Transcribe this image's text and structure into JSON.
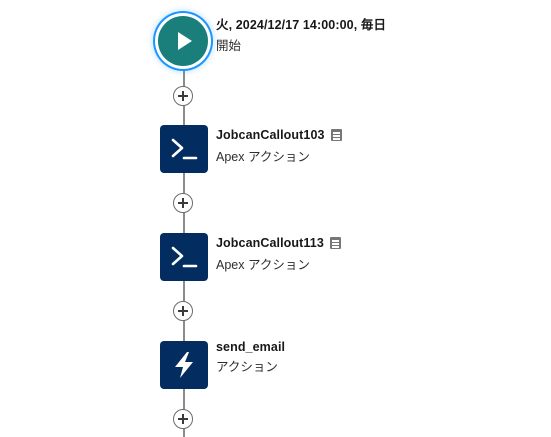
{
  "start": {
    "schedule": "火, 2024/12/17 14:00:00, 毎日",
    "label": "開始",
    "icon": "play-icon",
    "color": "#1a7f7a"
  },
  "nodes": [
    {
      "title": "JobcanCallout103",
      "subtitle": "Apex アクション",
      "icon": "terminal-icon",
      "has_doc": true
    },
    {
      "title": "JobcanCallout113",
      "subtitle": "Apex アクション",
      "icon": "terminal-icon",
      "has_doc": true
    },
    {
      "title": "send_email",
      "subtitle": "アクション",
      "icon": "lightning-bolt-icon",
      "has_doc": false
    }
  ],
  "colors": {
    "node_bg": "#032d60",
    "connector": "#8b8b8b",
    "selection_ring": "#1b96ff"
  }
}
